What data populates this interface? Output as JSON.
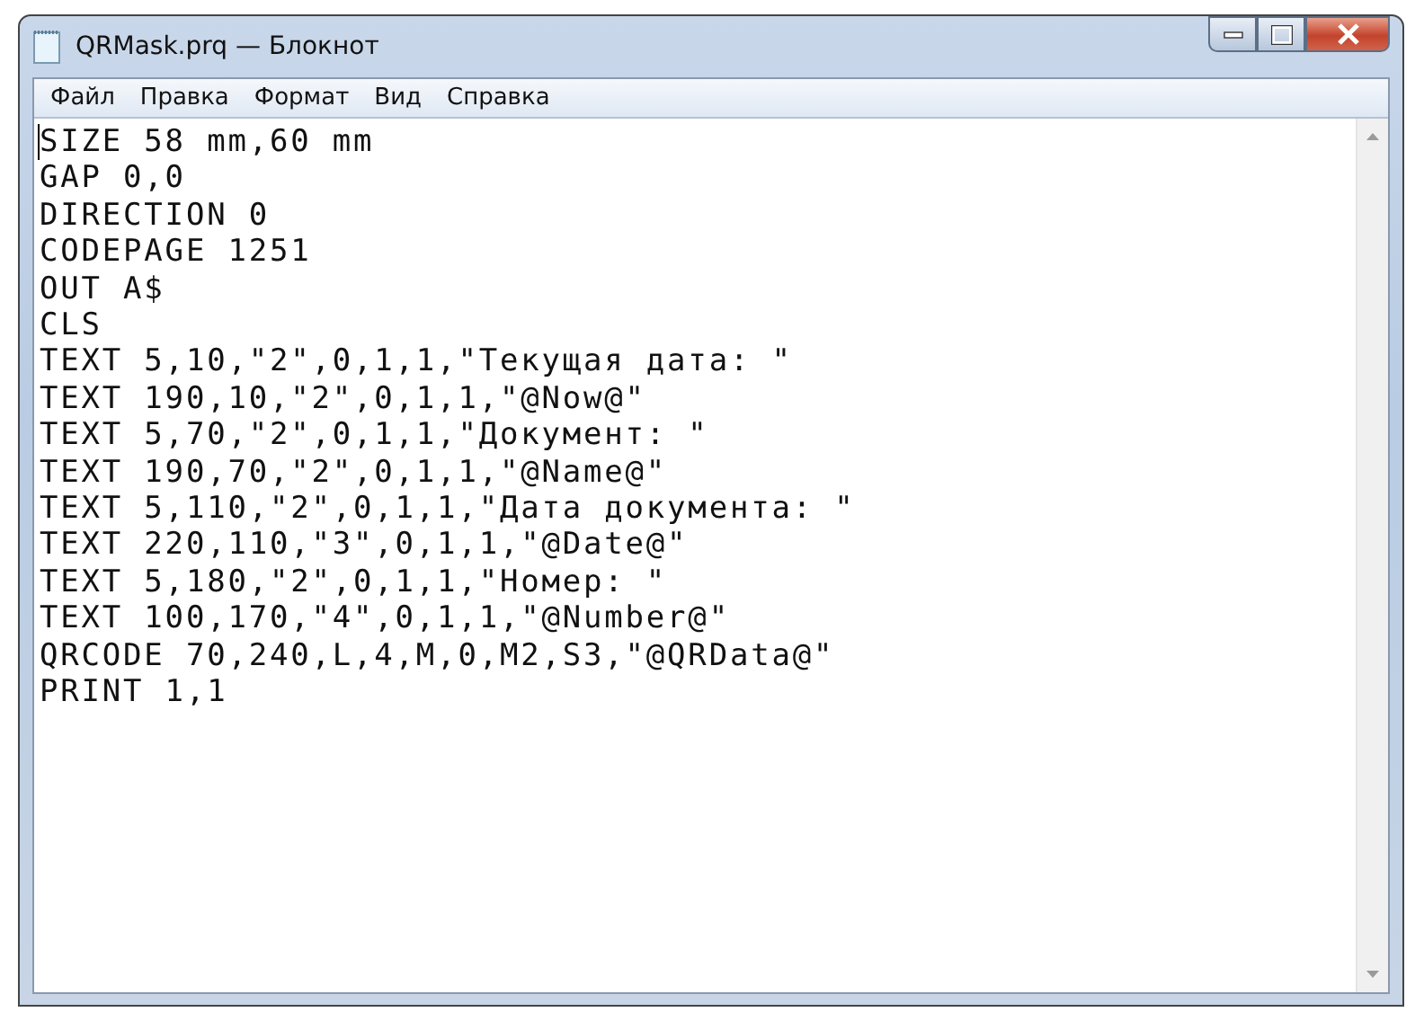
{
  "window": {
    "title": "QRMask.prq — Блокнот"
  },
  "menu": [
    "Файл",
    "Правка",
    "Формат",
    "Вид",
    "Справка"
  ],
  "editor": {
    "lines": [
      "SIZE 58 mm,60 mm",
      "GAP 0,0",
      "DIRECTION 0",
      "CODEPAGE 1251",
      "OUT A$",
      "CLS",
      "TEXT 5,10,\"2\",0,1,1,\"Текущая дата: \"",
      "TEXT 190,10,\"2\",0,1,1,\"@Now@\"",
      "TEXT 5,70,\"2\",0,1,1,\"Документ: \"",
      "TEXT 190,70,\"2\",0,1,1,\"@Name@\"",
      "TEXT 5,110,\"2\",0,1,1,\"Дата документа: \"",
      "TEXT 220,110,\"3\",0,1,1,\"@Date@\"",
      "TEXT 5,180,\"2\",0,1,1,\"Номер: \"",
      "TEXT 100,170,\"4\",0,1,1,\"@Number@\"",
      "QRCODE 70,240,L,4,M,0,M2,S3,\"@QRData@\"",
      "PRINT 1,1"
    ]
  }
}
